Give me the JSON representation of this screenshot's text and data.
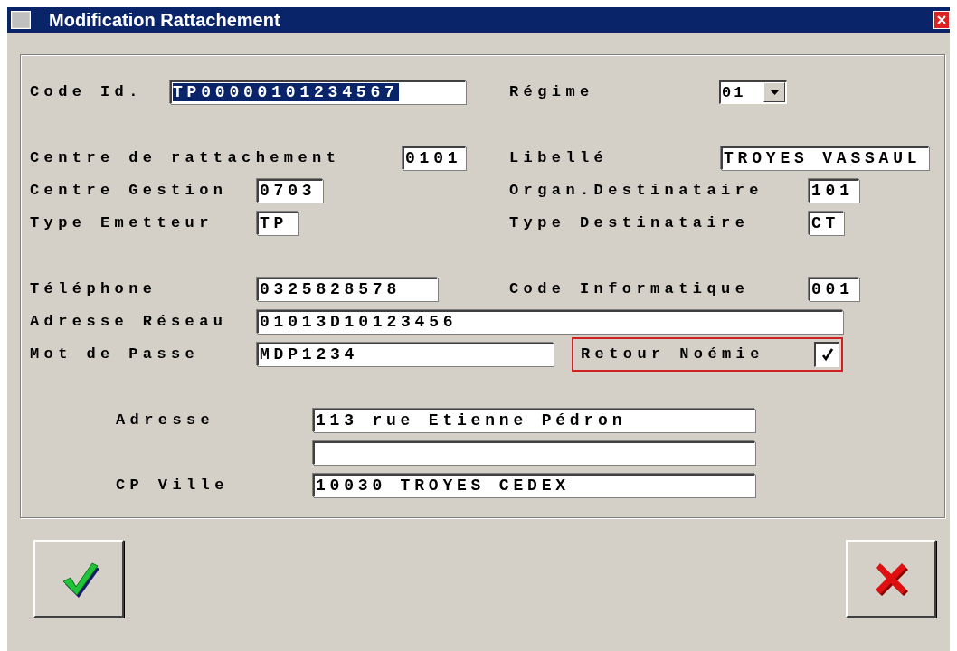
{
  "window": {
    "title": "Modification Rattachement"
  },
  "sections": [
    {
      "rows": [
        [
          {
            "kind": "label",
            "text": "Code Id."
          },
          {
            "kind": "field",
            "value": "TP00000101234567",
            "text_selected": true
          },
          {
            "kind": "label",
            "text": "Régime"
          },
          {
            "kind": "combo",
            "value": "01"
          }
        ]
      ]
    },
    {
      "rows": [
        [
          {
            "kind": "label",
            "text": "Centre de rattachement"
          },
          {
            "kind": "field",
            "value": "0101",
            "text_selected": false
          },
          {
            "kind": "label",
            "text": "Libellé"
          },
          {
            "kind": "field",
            "value": "TROYES VASSAUL",
            "text_selected": false
          }
        ],
        [
          {
            "kind": "label",
            "text": "Centre Gestion"
          },
          {
            "kind": "field",
            "value": "0703",
            "text_selected": false
          },
          {
            "kind": "label",
            "text": "Organ.Destinataire"
          },
          {
            "kind": "field",
            "value": "101",
            "text_selected": false
          }
        ],
        [
          {
            "kind": "label",
            "text": "Type Emetteur"
          },
          {
            "kind": "field",
            "value": "TP",
            "text_selected": false
          },
          {
            "kind": "label",
            "text": "Type Destinataire"
          },
          {
            "kind": "field",
            "value": "CT",
            "text_selected": false
          }
        ]
      ]
    },
    {
      "rows": [
        [
          {
            "kind": "label",
            "text": "Téléphone"
          },
          {
            "kind": "field",
            "value": "0325828578",
            "text_selected": false
          },
          {
            "kind": "label",
            "text": "Code Informatique"
          },
          {
            "kind": "field",
            "value": "001",
            "text_selected": false
          }
        ],
        [
          {
            "kind": "label",
            "text": "Adresse Réseau"
          },
          {
            "kind": "field",
            "value": "01013D10123456",
            "text_selected": false
          }
        ],
        [
          {
            "kind": "label",
            "text": "Mot de Passe"
          },
          {
            "kind": "field",
            "value": "MDP1234",
            "text_selected": false
          },
          {
            "kind": "check",
            "text": "Retour Noémie",
            "checked": true,
            "focused": true
          }
        ]
      ]
    },
    {
      "rows": [
        [
          {
            "kind": "label",
            "text": "Adresse"
          },
          {
            "kind": "field",
            "value": "113 rue Etienne Pédron",
            "text_selected": false
          }
        ],
        [
          {
            "kind": "field"
          }
        ],
        [
          {
            "kind": "label",
            "text": "CP Ville"
          },
          {
            "kind": "field",
            "value": "10030 TROYES CEDEX",
            "text_selected": false
          }
        ]
      ]
    }
  ],
  "buttons": [
    {
      "kind": "ok"
    },
    {
      "kind": "cancel"
    }
  ]
}
